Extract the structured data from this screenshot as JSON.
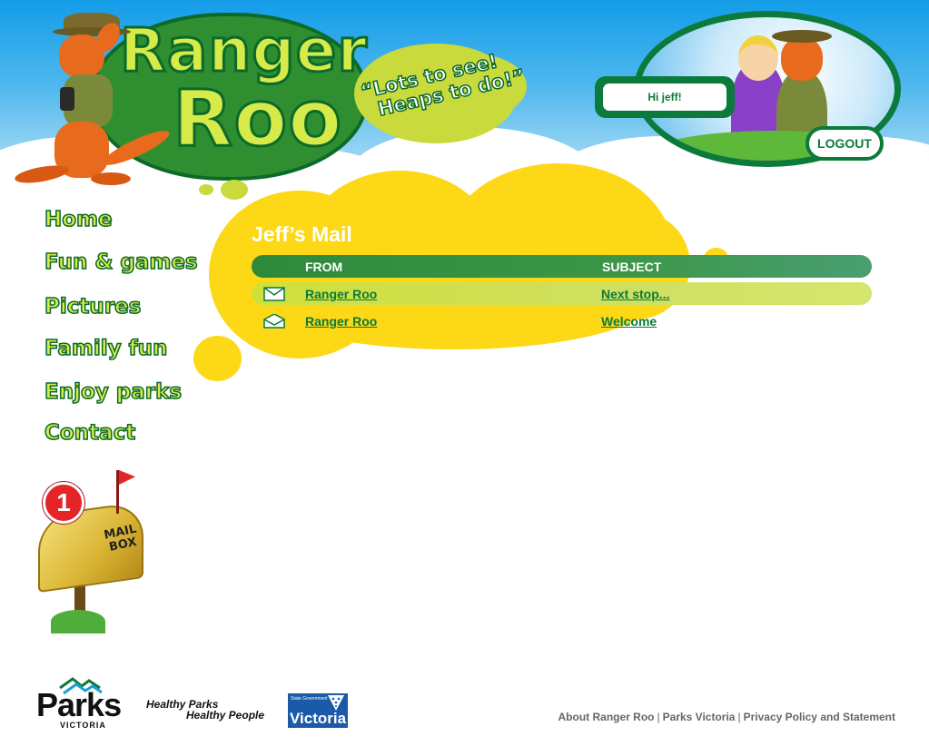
{
  "header": {
    "logo_line1": "Ranger",
    "logo_line2": "Roo",
    "slogan_line1": "“Lots to see!",
    "slogan_line2": "Heaps to do!”"
  },
  "user": {
    "greeting": "Hi jeff!",
    "logout_label": "LOGOUT"
  },
  "nav": {
    "items": [
      "Home",
      "Fun & games",
      "Pictures",
      "Family fun",
      "Enjoy parks",
      "Contact"
    ]
  },
  "mail": {
    "title": "Jeff’s Mail",
    "col_from": "FROM",
    "col_subject": "SUBJECT",
    "messages": [
      {
        "from": "Ranger Roo",
        "subject": "Next stop...",
        "status": "unread"
      },
      {
        "from": "Ranger Roo",
        "subject": "Welcome",
        "status": "read"
      }
    ]
  },
  "mailbox": {
    "count": "1",
    "label_line1": "MAIL",
    "label_line2": "BOX"
  },
  "footer": {
    "parks_logo": "Parks",
    "parks_sub": "VICTORIA",
    "hp_line1": "Healthy Parks",
    "hp_line2": "Healthy People",
    "vic_small": "State Government",
    "vic_logo": "Victoria",
    "links": [
      "About Ranger Roo",
      "Parks Victoria",
      "Privacy Policy and Statement"
    ]
  },
  "colors": {
    "brand_green": "#0b7a3a",
    "yellow": "#fdd816",
    "lime": "#d6ea4a",
    "sky": "#139ce8"
  }
}
